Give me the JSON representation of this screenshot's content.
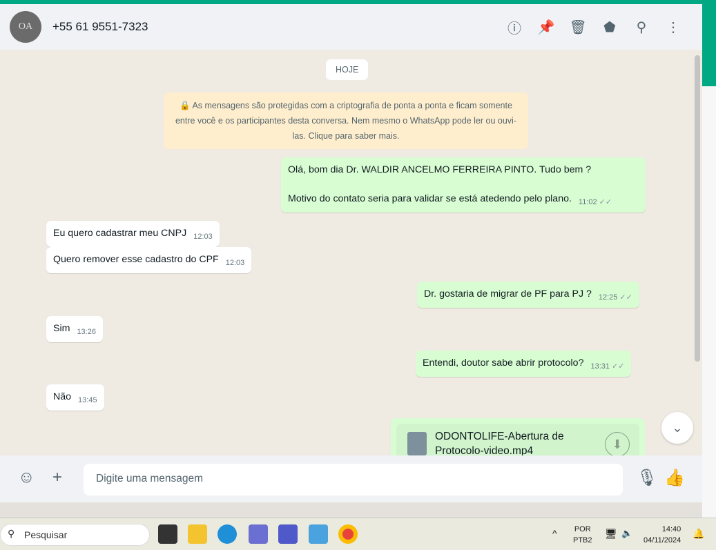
{
  "header": {
    "contact": "+55 61 9551-7323",
    "avatar_text": "OA"
  },
  "chat": {
    "day": "HOJE",
    "encryption": "🔒 As mensagens são protegidas com a criptografia de ponta a ponta e ficam somente entre você e os participantes desta conversa. Nem mesmo o WhatsApp pode ler ou ouvi-las. Clique para saber mais.",
    "messages": [
      {
        "dir": "out",
        "line1": "Olá, bom dia Dr. WALDIR ANCELMO FERREIRA PINTO. Tudo bem ?",
        "line2": "Motivo do contato seria para validar se está atedendo pelo plano.",
        "time": "11:02"
      },
      {
        "dir": "in",
        "text": "Eu quero cadastrar meu CNPJ",
        "time": "12:03"
      },
      {
        "dir": "in",
        "text": "Quero remover esse cadastro do CPF",
        "time": "12:03"
      },
      {
        "dir": "out",
        "text": "Dr. gostaria de migrar de PF para PJ ?",
        "time": "12:25"
      },
      {
        "dir": "in",
        "text": "Sim",
        "time": "13:26"
      },
      {
        "dir": "out",
        "text": "Entendi, doutor sabe abrir protocolo?",
        "time": "13:31"
      },
      {
        "dir": "in",
        "text": "Não",
        "time": "13:45"
      },
      {
        "dir": "out",
        "file": "ODONTOLIFE-Abertura de Protocolo-video.mp4"
      }
    ]
  },
  "footer": {
    "placeholder": "Digite uma mensagem"
  },
  "taskbar": {
    "search": "Pesquisar",
    "lang1": "POR",
    "lang2": "PTB2",
    "time": "14:40",
    "date": "04/11/2024"
  }
}
